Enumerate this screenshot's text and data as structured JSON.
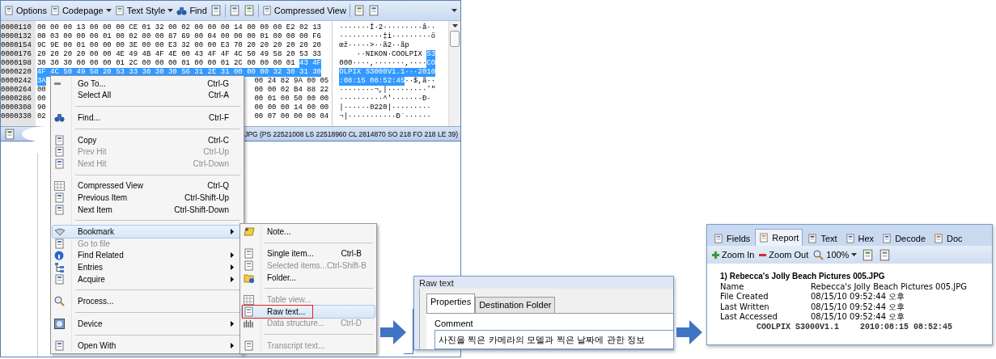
{
  "hex_window": {
    "toolbar": [
      {
        "kind": "button",
        "label": "Options"
      },
      {
        "kind": "dropdown",
        "label": "Codepage"
      },
      {
        "kind": "dropdown",
        "label": "Text Style"
      },
      {
        "kind": "button",
        "label": "Find"
      },
      {
        "kind": "icon"
      },
      {
        "kind": "separator"
      },
      {
        "kind": "icon"
      },
      {
        "kind": "icon"
      },
      {
        "kind": "separator"
      },
      {
        "kind": "button",
        "label": "Compressed View"
      },
      {
        "kind": "separator"
      },
      {
        "kind": "icon"
      },
      {
        "kind": "icon"
      }
    ],
    "rows": [
      {
        "address": "0000110",
        "bytes": [
          {
            "text": "00 00 00 13 00 00 00 CE 01 32 00 02 00 00 00 14 00 00 00 E2 02 13",
            "selected": false
          }
        ],
        "chars": [
          {
            "text": "·······Î·2·········â··",
            "selected": false
          }
        ]
      },
      {
        "address": "0000132",
        "bytes": [
          {
            "text": "00 03 00 00 00 01 00 02 00 00 87 69 00 04 00 00 00 01 00 00 00 F6",
            "selected": false
          }
        ],
        "chars": [
          {
            "text": "··········‡i·········ö",
            "selected": false
          }
        ]
      },
      {
        "address": "0000154",
        "bytes": [
          {
            "text": "9C 9E 00 01 00 00 00 3E 00 00 E3 32 00 00 E3 70 20 20 20 20 20 20",
            "selected": false
          }
        ],
        "chars": [
          {
            "text": "œž·····>··ã2··ãp",
            "selected": false
          }
        ]
      },
      {
        "address": "0000176",
        "bytes": [
          {
            "text": "20 20 20 20 00 00 4E 49 4B 4F 4E 00 43 4F 4F 4C 50 49 58 20 53 33",
            "selected": false
          }
        ],
        "chars": [
          {
            "text": "    ··NIKON·COOLPIX ",
            "selected": false
          },
          {
            "text": "S3",
            "selected": true
          }
        ]
      },
      {
        "address": "0000198",
        "bytes": [
          {
            "text": "30 30 30 00 00 00 01 2C 00 00 00 01 00 00 01 2C 00 00 00 01",
            "selected": false
          },
          {
            "text": "43 4F",
            "selected": true
          }
        ],
        "chars": [
          {
            "text": "000····,·······,····",
            "selected": false
          },
          {
            "text": "CO",
            "selected": true
          }
        ]
      },
      {
        "address": "0000220",
        "bytes": [
          {
            "text": "4F 4C 50 49 58 20 53 33 30 30 30 56 31 2E 31 00 00 00 32 30 31 30",
            "selected": true
          }
        ],
        "chars": [
          {
            "text": "OLPIX S3000V1.1···2010",
            "selected": true
          }
        ]
      },
      {
        "address": "0000242",
        "bytes": [
          {
            "text": "3A",
            "selected": true
          }
        ],
        "bytes_tail": "00 24 82 9A 00 05",
        "chars": [
          {
            "text": ":08:15 08:52:45",
            "selected": true
          },
          {
            "text": "··$,ã··",
            "selected": false
          }
        ]
      },
      {
        "address": "0000264",
        "bytes": [
          {
            "text": "00",
            "selected": false
          }
        ],
        "bytes_tail": "00 00 02 B4 88 22",
        "chars": [
          {
            "text": "········¬,|·········˚\"",
            "selected": false
          }
        ]
      },
      {
        "address": "0000286",
        "bytes": [
          {
            "text": "00",
            "selected": false
          }
        ],
        "bytes_tail": "00 01 00 50 00 00",
        "chars": [
          {
            "text": "··········^'·······Ð·",
            "selected": false
          }
        ]
      },
      {
        "address": "0000308",
        "bytes": [
          {
            "text": "90",
            "selected": false
          }
        ],
        "bytes_tail": "00 00 00 14 00 00",
        "chars": [
          {
            "text": "|······0220|·········",
            "selected": false
          }
        ]
      },
      {
        "address": "0000330",
        "bytes": [
          {
            "text": "02",
            "selected": false
          }
        ],
        "bytes_tail": "00 07 00 00 00 04",
        "chars": [
          {
            "text": "¬|···········Ð`······",
            "selected": false
          }
        ]
      }
    ],
    "status": "JPG (PS 22521008 LS 22518960 CL 2814870 SO 218 FO 218 LE 39)"
  },
  "menu": {
    "items": [
      {
        "kind": "item",
        "label": "Go To...",
        "shortcut": "Ctrl-G",
        "disabled": false,
        "submenu": false,
        "selected": false
      },
      {
        "kind": "item",
        "label": "Select All",
        "shortcut": "Ctrl-A",
        "disabled": false,
        "submenu": false,
        "selected": false
      },
      {
        "kind": "separator"
      },
      {
        "kind": "item",
        "label": "Find...",
        "shortcut": "Ctrl-F",
        "disabled": false,
        "submenu": false,
        "selected": false
      },
      {
        "kind": "separator"
      },
      {
        "kind": "item",
        "label": "Copy",
        "shortcut": "Ctrl-C",
        "disabled": false,
        "submenu": false,
        "selected": false
      },
      {
        "kind": "item",
        "label": "Prev Hit",
        "shortcut": "Ctrl-Up",
        "disabled": true,
        "submenu": false,
        "selected": false
      },
      {
        "kind": "item",
        "label": "Next Hit",
        "shortcut": "Ctrl-Down",
        "disabled": true,
        "submenu": false,
        "selected": false
      },
      {
        "kind": "separator"
      },
      {
        "kind": "item",
        "label": "Compressed View",
        "shortcut": "Ctrl-Q",
        "disabled": false,
        "submenu": false,
        "selected": false
      },
      {
        "kind": "item",
        "label": "Previous Item",
        "shortcut": "Ctrl-Shift-Up",
        "disabled": false,
        "submenu": false,
        "selected": false
      },
      {
        "kind": "item",
        "label": "Next Item",
        "shortcut": "Ctrl-Shift-Down",
        "disabled": false,
        "submenu": false,
        "selected": false
      },
      {
        "kind": "separator"
      },
      {
        "kind": "item",
        "label": "Bookmark",
        "disabled": false,
        "submenu": true,
        "selected": true
      },
      {
        "kind": "item",
        "label": "Go to file",
        "disabled": true,
        "submenu": false,
        "selected": false
      },
      {
        "kind": "item",
        "label": "Find Related",
        "disabled": false,
        "submenu": true,
        "selected": false
      },
      {
        "kind": "item",
        "label": "Entries",
        "disabled": false,
        "submenu": true,
        "selected": false
      },
      {
        "kind": "item",
        "label": "Acquire",
        "disabled": false,
        "submenu": true,
        "selected": false
      },
      {
        "kind": "separator"
      },
      {
        "kind": "item",
        "label": "Process...",
        "disabled": false,
        "submenu": false,
        "selected": false
      },
      {
        "kind": "separator"
      },
      {
        "kind": "item",
        "label": "Device",
        "disabled": false,
        "submenu": true,
        "selected": false
      },
      {
        "kind": "separator"
      },
      {
        "kind": "item",
        "label": "Open With",
        "disabled": false,
        "submenu": true,
        "selected": false
      }
    ]
  },
  "submenu": {
    "items": [
      {
        "kind": "item",
        "label": "Note...",
        "disabled": false,
        "selected": false
      },
      {
        "kind": "separator"
      },
      {
        "kind": "item",
        "label": "Single item...",
        "shortcut": "Ctrl-B",
        "disabled": false,
        "selected": false
      },
      {
        "kind": "item",
        "label": "Selected items...",
        "shortcut": "Ctrl-Shift-B",
        "disabled": true,
        "selected": false
      },
      {
        "kind": "item",
        "label": "Folder...",
        "disabled": false,
        "selected": false
      },
      {
        "kind": "separator"
      },
      {
        "kind": "item",
        "label": "Table view...",
        "disabled": true,
        "selected": false
      },
      {
        "kind": "item",
        "label": "Raw text...",
        "disabled": false,
        "selected": true
      },
      {
        "kind": "item",
        "label": "Data structure...",
        "shortcut": "Ctrl-D",
        "disabled": true,
        "selected": false
      },
      {
        "kind": "separator"
      },
      {
        "kind": "item",
        "label": "Transcript text...",
        "disabled": true,
        "selected": false
      }
    ]
  },
  "dialog": {
    "title": "Raw text",
    "tabs": [
      {
        "label": "Properties",
        "selected": true
      },
      {
        "label": "Destination Folder",
        "selected": false
      }
    ],
    "field_label": "Comment",
    "field_value": "사진을 찍은 카메라의 모델과 찍은 날짜에 관한 정보"
  },
  "report": {
    "tabs": [
      {
        "label": "Fields",
        "selected": false
      },
      {
        "label": "Report",
        "selected": true
      },
      {
        "label": "Text",
        "selected": false
      },
      {
        "label": "Hex",
        "selected": false
      },
      {
        "label": "Decode",
        "selected": false
      },
      {
        "label": "Doc",
        "selected": false
      }
    ],
    "toolbar": [
      {
        "kind": "button",
        "label": "Zoom In"
      },
      {
        "kind": "button",
        "label": "Zoom Out"
      },
      {
        "kind": "dropdown",
        "label": "100%"
      },
      {
        "kind": "icon"
      },
      {
        "kind": "icon"
      }
    ],
    "heading": "1) Rebecca's Jolly Beach Pictures 005.JPG",
    "fields": [
      {
        "label": "Name",
        "value": "Rebecca's Jolly Beach Pictures 005.JPG"
      },
      {
        "label": "File Created",
        "value": "08/15/10 09:52:44 오후"
      },
      {
        "label": "Last Written",
        "value": "08/15/10 09:52:44 오후"
      },
      {
        "label": "Last Accessed",
        "value": "08/15/10 09:52:44 오후"
      }
    ],
    "raw_line": [
      "COOLPIX S3000V1.1",
      "2010:08:15 08:52:45"
    ]
  }
}
